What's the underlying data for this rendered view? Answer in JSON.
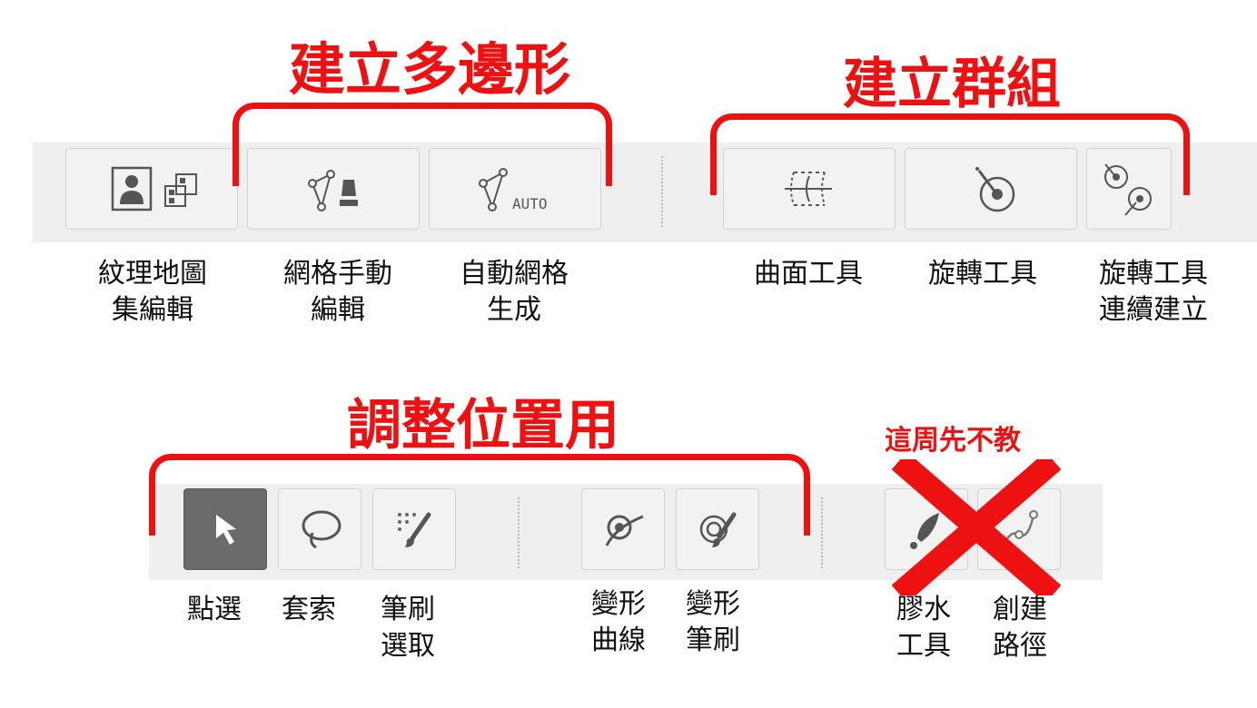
{
  "colors": {
    "annotation": "#ee1111",
    "toolbar_bg": "#efefef",
    "button_bg": "#f2f2f2",
    "active_button": "#6b6b6b"
  },
  "annotations": {
    "create_polygon": "建立多邊形",
    "create_group": "建立群組",
    "adjust_position": "調整位置用",
    "not_taught": "這周先不教"
  },
  "toolbar_top": {
    "buttons": [
      {
        "icon": "texture-atlas-icon",
        "label_line1": "紋理地圖",
        "label_line2": "集編輯"
      },
      {
        "icon": "manual-mesh-pen-icon",
        "label_line1": "網格手動",
        "label_line2": "編輯"
      },
      {
        "icon": "auto-mesh-icon",
        "icon_text": "AUTO",
        "label_line1": "自動網格",
        "label_line2": "生成"
      },
      {
        "icon": "surface-tool-icon",
        "label_line1": "曲面工具",
        "label_line2": ""
      },
      {
        "icon": "rotation-tool-icon",
        "label_line1": "旋轉工具",
        "label_line2": ""
      },
      {
        "icon": "rotation-chain-icon",
        "label_line1": "旋轉工具",
        "label_line2": "連續建立"
      }
    ]
  },
  "toolbar_bottom": {
    "buttons": [
      {
        "icon": "pointer-arrow-icon",
        "label_line1": "點選",
        "label_line2": "",
        "selected": true
      },
      {
        "icon": "lasso-icon",
        "label_line1": "套索",
        "label_line2": ""
      },
      {
        "icon": "brush-select-icon",
        "label_line1": "筆刷",
        "label_line2": "選取"
      },
      {
        "icon": "deform-curve-icon",
        "label_line1": "變形",
        "label_line2": "曲線"
      },
      {
        "icon": "deform-brush-icon",
        "label_line1": "變形",
        "label_line2": "筆刷"
      },
      {
        "icon": "glue-tool-icon",
        "label_line1": "膠水",
        "label_line2": "工具"
      },
      {
        "icon": "create-path-icon",
        "label_line1": "創建",
        "label_line2": "路徑"
      }
    ]
  }
}
